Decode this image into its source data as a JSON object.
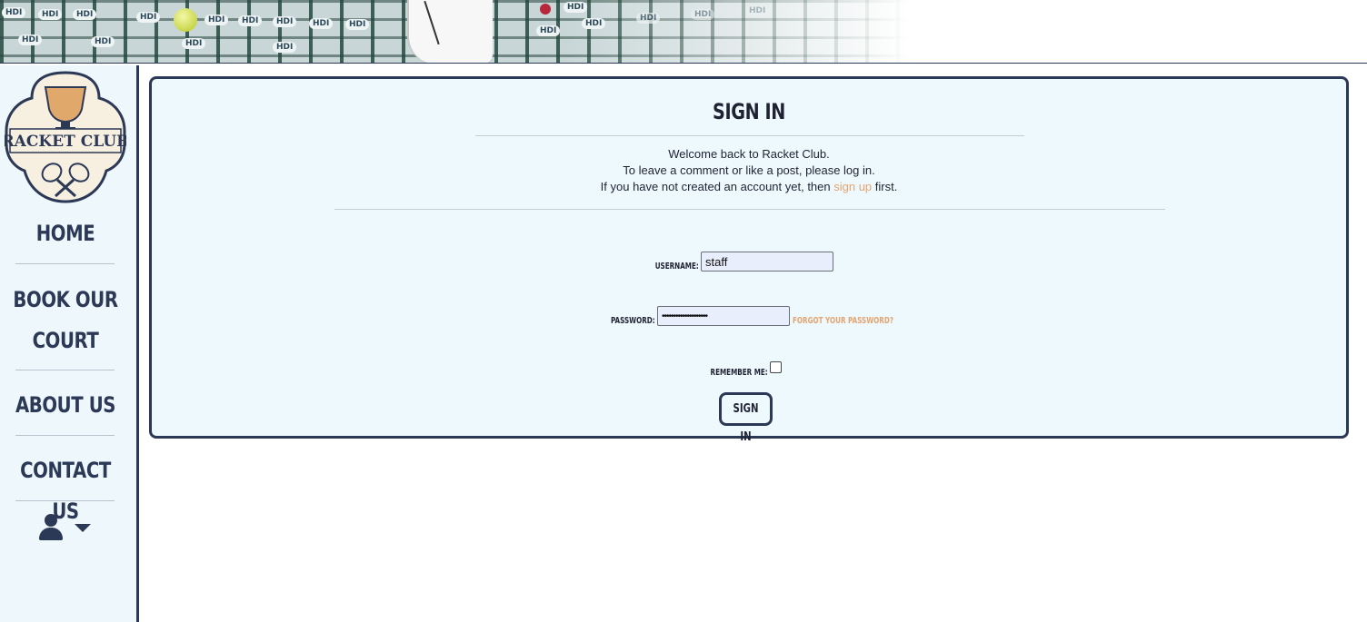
{
  "header": {
    "seat_label": "HDI"
  },
  "logo": {
    "text": "RACKET CLUB"
  },
  "nav": {
    "home": "HOME",
    "book_line1": "BOOK OUR",
    "book_line2": "COURT",
    "about": "ABOUT US",
    "contact": "CONTACT US",
    "user_icon": "user-icon",
    "caret_icon": "caret-down-icon"
  },
  "signin": {
    "title": "SIGN IN",
    "welcome_line1": "Welcome back to Racket Club.",
    "welcome_line2": "To leave a comment or like a post, please log in.",
    "welcome_line3_pre": "If you have not created an account yet, then ",
    "signup_link": "sign up",
    "welcome_line3_post": " first.",
    "username_label": "USERNAME:",
    "username_value": "staff",
    "password_label": "PASSWORD:",
    "password_value": "••••••••••••••••••••",
    "forgot_link": "FORGOT YOUR PASSWORD?",
    "remember_label": "REMEMBER ME:",
    "submit_label": "SIGN IN"
  },
  "colors": {
    "navy": "#2b3856",
    "accent_link": "#e3a472",
    "panel_bg": "#eef9fd"
  }
}
